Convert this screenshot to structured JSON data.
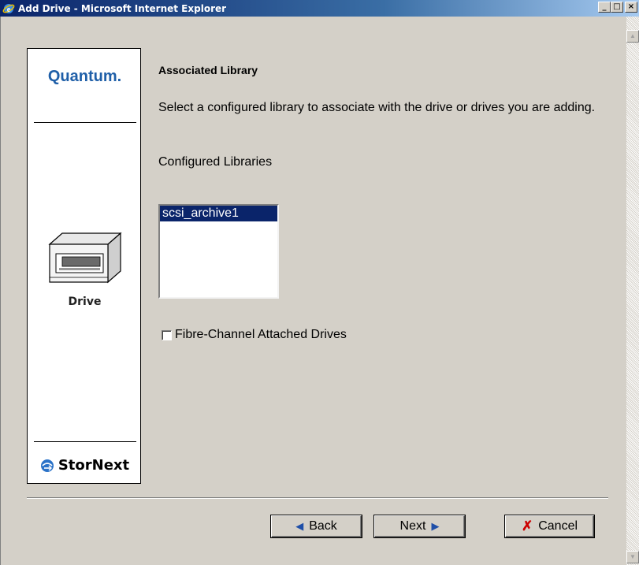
{
  "window": {
    "title": "Add Drive - Microsoft Internet Explorer",
    "minimize": "_",
    "maximize": "□",
    "close": "×"
  },
  "sidebar": {
    "logo_text": "Quantum.",
    "device_label": "Drive",
    "product_logo_text": "StorNext"
  },
  "main": {
    "section_title": "Associated Library",
    "description": "Select a configured library to associate with the drive or drives you are adding.",
    "libraries_label": "Configured Libraries",
    "libraries": [
      {
        "name": "scsi_archive1",
        "selected": true
      }
    ],
    "fibre_channel_label": "Fibre-Channel Attached Drives",
    "fibre_channel_checked": false
  },
  "buttons": {
    "back_label": "Back",
    "next_label": "Next",
    "cancel_label": "Cancel"
  },
  "colors": {
    "title_bar": "#0a246a",
    "quantum_logo": "#1f5fa8",
    "selection": "#0a246a",
    "cancel_icon": "#cc0000"
  }
}
